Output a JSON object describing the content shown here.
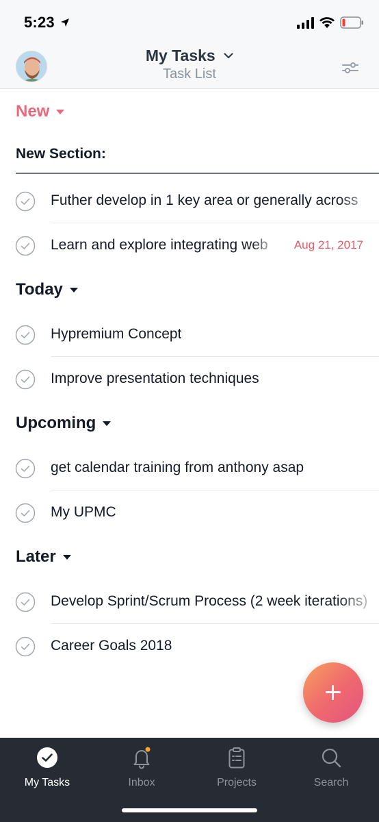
{
  "status_bar": {
    "time": "5:23"
  },
  "header": {
    "title": "My Tasks",
    "subtitle": "Task List"
  },
  "sections": {
    "new": {
      "label": "New"
    },
    "new_section_label": "New Section:",
    "today": {
      "label": "Today"
    },
    "upcoming": {
      "label": "Upcoming"
    },
    "later": {
      "label": "Later"
    }
  },
  "tasks": {
    "t1": {
      "text": "Futher develop in 1 key area or generally across"
    },
    "t2": {
      "text": "Learn and explore integrating web",
      "date": "Aug 21, 2017"
    },
    "t3": {
      "text": "Hypremium Concept"
    },
    "t4": {
      "text": "Improve presentation techniques"
    },
    "t5": {
      "text": "get calendar training from anthony asap"
    },
    "t6": {
      "text": "My UPMC"
    },
    "t7": {
      "text": "Develop Sprint/Scrum Process (2 week iterations)"
    },
    "t8": {
      "text": "Career Goals 2018"
    }
  },
  "nav": {
    "my_tasks": "My Tasks",
    "inbox": "Inbox",
    "projects": "Projects",
    "search": "Search"
  },
  "colors": {
    "accent_pink": "#e8697d",
    "date_red": "#e35b6b",
    "nav_bg": "#262b34",
    "inbox_badge": "#f5a623"
  }
}
